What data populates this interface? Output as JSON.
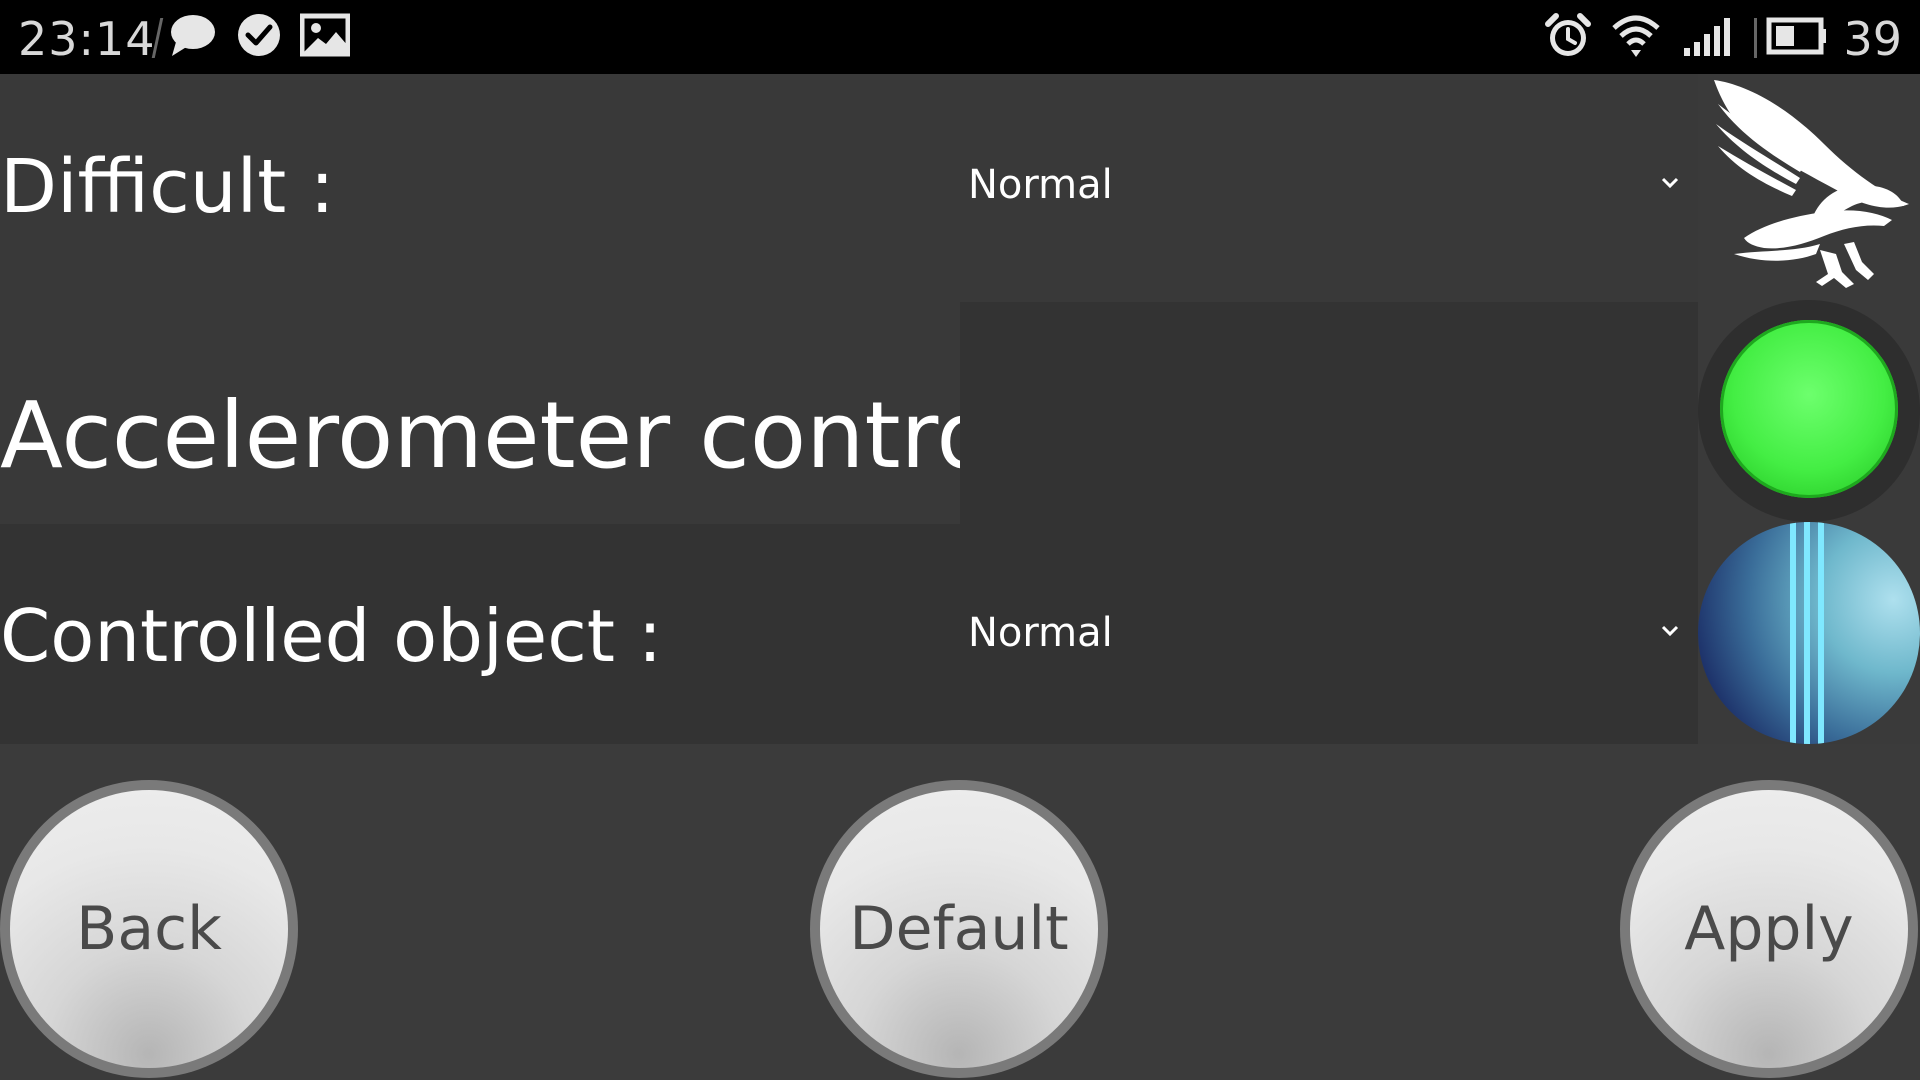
{
  "status_bar": {
    "time": "23:14",
    "battery_level": "39",
    "icons": [
      "chat-bubble-icon",
      "check-circle-icon",
      "image-icon",
      "alarm-icon",
      "wifi-icon",
      "signal-icon",
      "battery-icon"
    ]
  },
  "settings": {
    "difficult": {
      "label": "Difficult :",
      "value": "Normal"
    },
    "accelerometer": {
      "label": "Accelerometer control :",
      "state": "on",
      "indicator_color": "#44ee44"
    },
    "controlled_object": {
      "label": "Controlled object :",
      "value": "Normal"
    }
  },
  "buttons": {
    "back": "Back",
    "default": "Default",
    "apply": "Apply"
  },
  "colors": {
    "background": "#3b3b3b",
    "status_bar": "#000000",
    "button_face": "#e8e8e8",
    "button_text": "#4a4a4a"
  }
}
